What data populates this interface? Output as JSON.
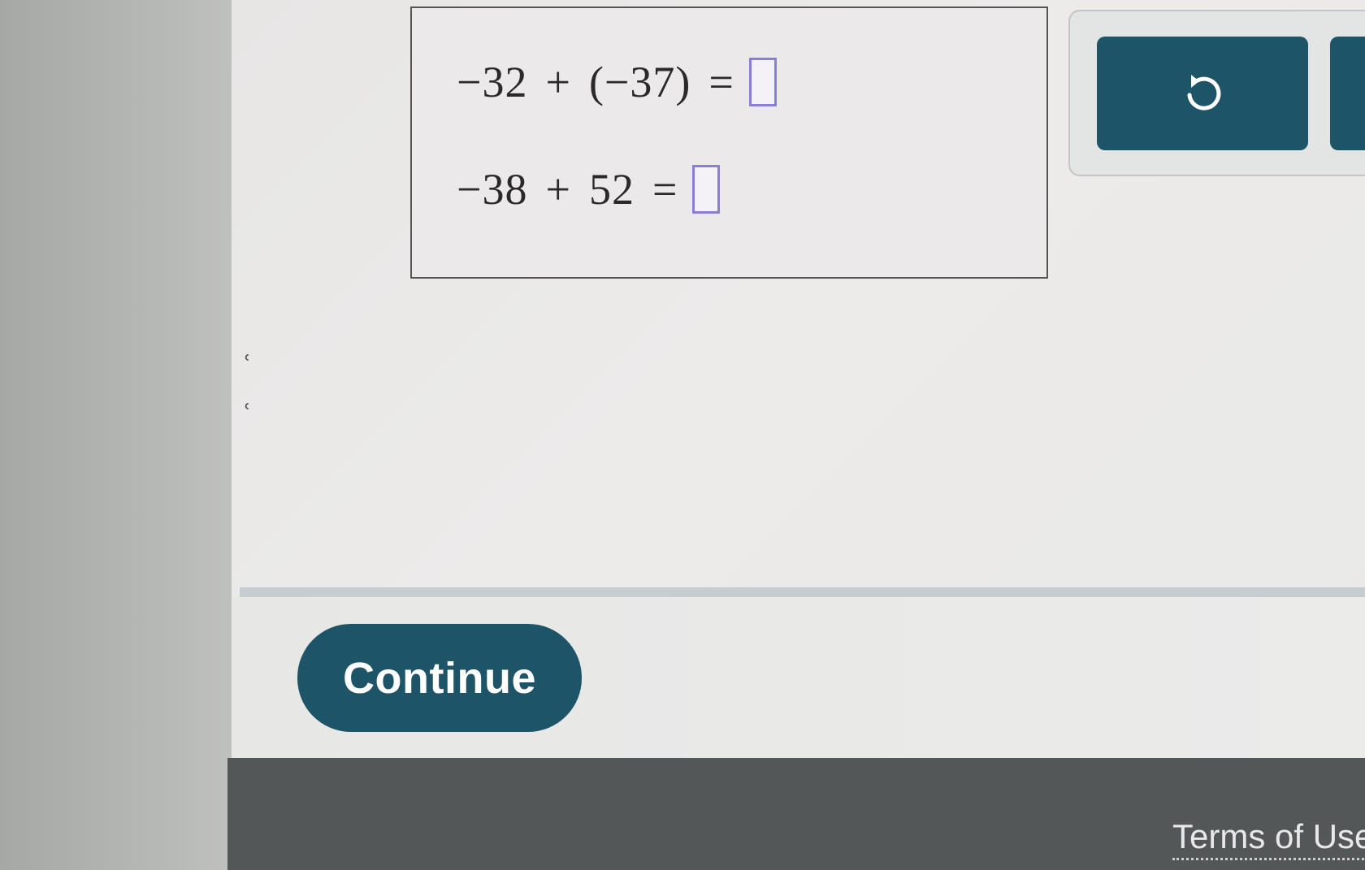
{
  "problem": {
    "equations": [
      {
        "terms": [
          "−32",
          "+",
          "(−37)",
          "="
        ],
        "answer": ""
      },
      {
        "terms": [
          "−38",
          "+",
          "52",
          "="
        ],
        "answer": ""
      }
    ]
  },
  "tools": {
    "undo_icon": "undo-icon"
  },
  "actions": {
    "continue_label": "Continue"
  },
  "footer": {
    "terms_label": "Terms of Use"
  },
  "colors": {
    "primary": "#1e5467",
    "answer_box_border": "#8a7fd6",
    "footer_bg": "#545757"
  }
}
